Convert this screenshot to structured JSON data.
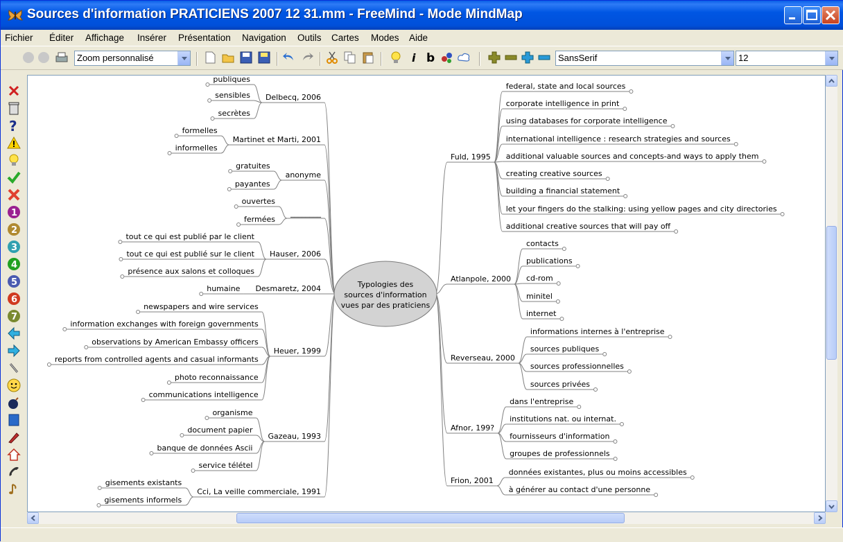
{
  "window": {
    "title": "Sources d'information PRATICIENS 2007 12 31.mm - FreeMind - Mode MindMap",
    "controls": [
      "minimize",
      "maximize",
      "close"
    ]
  },
  "menubar": {
    "items": [
      "Fichier",
      "Éditer",
      "Affichage",
      "Insérer",
      "Présentation",
      "Navigation",
      "Outils",
      "Cartes",
      "Modes",
      "Aide"
    ]
  },
  "toolbar": {
    "zoom": "Zoom personnalisé",
    "font_family": "SansSerif",
    "font_size": "12",
    "icons": [
      "back-icon",
      "forward-icon",
      "print-icon",
      "new-icon",
      "open-icon",
      "save-icon",
      "save-as-icon",
      "undo-icon",
      "redo-icon",
      "cut-icon",
      "copy-icon",
      "paste-icon",
      "idea-icon",
      "italic-icon",
      "bold-icon",
      "cloud-icon",
      "node-color-icon",
      "zoom-in-icon",
      "zoom-out-icon",
      "expand-icon",
      "collapse-icon"
    ]
  },
  "left_icons": [
    "remove-icon",
    "trash-icon",
    "question-icon",
    "warning-icon",
    "idea-icon",
    "checkmark-icon",
    "cross-icon",
    "priority-1-icon",
    "priority-2-icon",
    "priority-3-icon",
    "priority-4-icon",
    "priority-5-icon",
    "priority-6-icon",
    "priority-7-icon",
    "arrow-left-icon",
    "arrow-right-icon",
    "attachment-icon",
    "smiley-icon",
    "bomb-icon",
    "book-icon",
    "pen-icon",
    "home-icon",
    "phone-icon",
    "music-icon"
  ],
  "mindmap": {
    "root": [
      "Typologies des",
      "sources d'information",
      "vues par des praticiens"
    ],
    "left": [
      {
        "label": "Delbecq, 2006",
        "children": [
          "publiques",
          "sensibles",
          "secrètes"
        ]
      },
      {
        "label": "Martinet et Marti, 2001",
        "children": [
          "formelles",
          "informelles"
        ]
      },
      {
        "label": "anonyme",
        "children": [
          "gratuites",
          "payantes"
        ]
      },
      {
        "label": "________",
        "children": [
          "ouvertes",
          "fermées"
        ]
      },
      {
        "label": "Hauser, 2006",
        "children": [
          "tout ce qui est publié par le client",
          "tout ce qui est publié sur le client",
          "présence aux salons et colloques"
        ]
      },
      {
        "label": "Desmaretz, 2004",
        "children": [
          "humaine"
        ]
      },
      {
        "label": "Heuer, 1999",
        "children": [
          "newspapers and wire services",
          "information exchanges with foreign governments",
          "observations by American Embassy officers",
          "reports from controlled agents and casual informants",
          "photo reconnaissance",
          "communications intelligence"
        ]
      },
      {
        "label": "Gazeau, 1993",
        "children": [
          "organisme",
          "document papier",
          "banque de données Ascii",
          "service télétel"
        ]
      },
      {
        "label": "Cci, La veille commerciale, 1991",
        "children": [
          "gisements existants",
          "gisements informels"
        ]
      }
    ],
    "right": [
      {
        "label": "Fuld, 1995",
        "children": [
          "federal, state and local sources",
          "corporate intelligence in print",
          "using databases for corporate intelligence",
          "international intelligence : research strategies and sources",
          "additional valuable sources and concepts-and ways to apply them",
          "creating creative sources",
          "building a financial statement",
          "let your fingers do the stalking: using yellow pages and city directories",
          "additional creative sources that will pay off"
        ]
      },
      {
        "label": "Atlanpole, 2000",
        "children": [
          "contacts",
          "publications",
          "cd-rom",
          "minitel",
          "internet"
        ]
      },
      {
        "label": "Reverseau, 2000",
        "children": [
          "informations internes à l'entreprise",
          "sources publiques",
          "sources professionnelles",
          "sources privées"
        ]
      },
      {
        "label": "Afnor, 199?",
        "children": [
          "dans l'entreprise",
          "institutions nat. ou internat.",
          "fournisseurs d'information",
          "groupes de professionnels"
        ]
      },
      {
        "label": "Frion, 2001",
        "children": [
          "données existantes, plus ou moins accessibles",
          "à générer au contact d'une personne"
        ]
      }
    ]
  }
}
